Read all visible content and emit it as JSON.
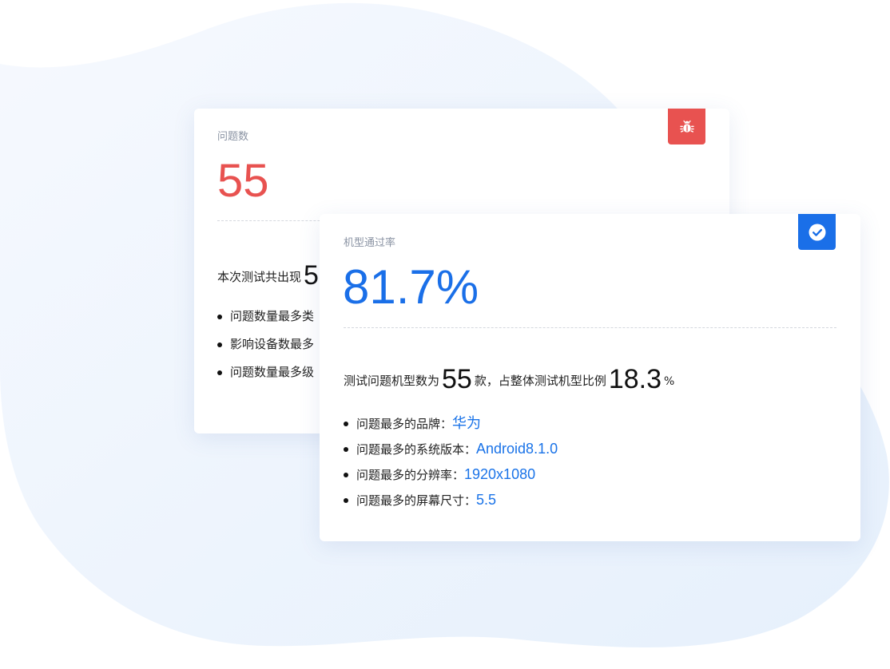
{
  "colors": {
    "accent_red": "#e85250",
    "accent_blue": "#1a6fe8",
    "value_blue": "#1a73e8"
  },
  "issues_card": {
    "label": "问题数",
    "count": "55",
    "summary_prefix": "本次测试共出现",
    "summary_number": "5",
    "badge_icon": "bug-icon",
    "items": [
      "问题数量最多类",
      "影响设备数最多",
      "问题数量最多级"
    ]
  },
  "pass_card": {
    "label": "机型通过率",
    "rate": "81.7%",
    "badge_icon": "check-circle-icon",
    "summary": {
      "prefix": "测试问题机型数为",
      "models": "55",
      "middle": "款，占整体测试机型比例",
      "ratio": "18.3",
      "unit": "%"
    },
    "items": [
      {
        "label": "问题最多的品牌：",
        "value": "华为"
      },
      {
        "label": "问题最多的系统版本：",
        "value": "Android8.1.0"
      },
      {
        "label": "问题最多的分辨率：",
        "value": "1920x1080"
      },
      {
        "label": "问题最多的屏幕尺寸：",
        "value": "5.5"
      }
    ]
  }
}
